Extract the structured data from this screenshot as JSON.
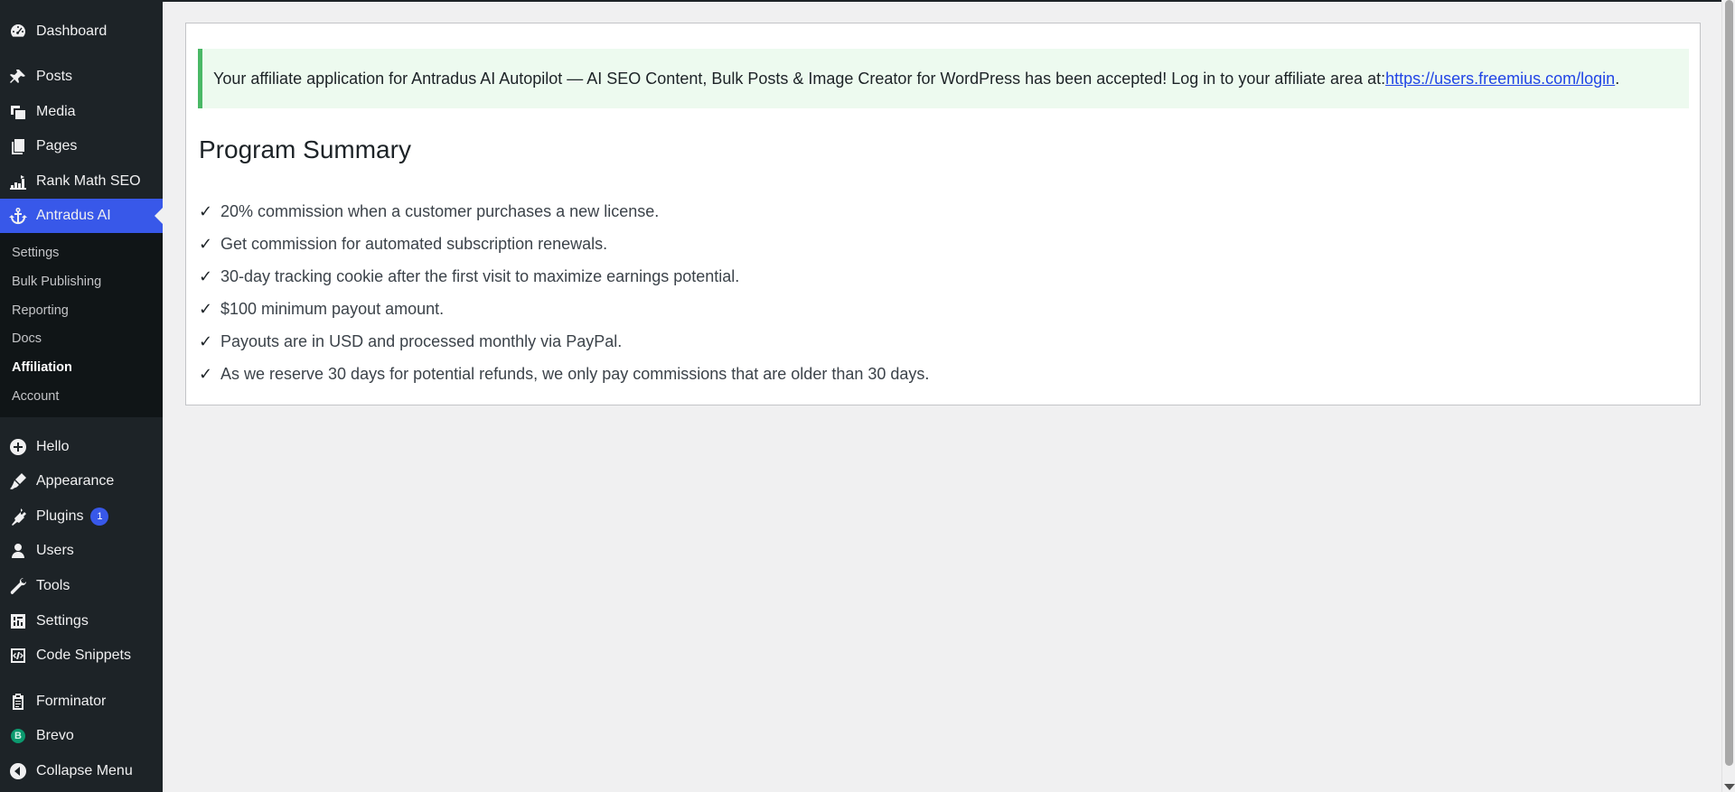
{
  "sidebar": {
    "items": [
      {
        "key": "dashboard",
        "label": "Dashboard",
        "icon": "dashboard-icon"
      },
      {
        "key": "posts",
        "label": "Posts",
        "icon": "pin-icon"
      },
      {
        "key": "media",
        "label": "Media",
        "icon": "media-icon"
      },
      {
        "key": "pages",
        "label": "Pages",
        "icon": "pages-icon"
      },
      {
        "key": "rank-math-seo",
        "label": "Rank Math SEO",
        "icon": "chart-icon"
      },
      {
        "key": "antradus-ai",
        "label": "Antradus AI",
        "icon": "anchor-icon"
      },
      {
        "key": "hello",
        "label": "Hello",
        "icon": "plus-circle-icon"
      },
      {
        "key": "appearance",
        "label": "Appearance",
        "icon": "brush-icon"
      },
      {
        "key": "plugins",
        "label": "Plugins",
        "icon": "plug-icon",
        "badge": "1"
      },
      {
        "key": "users",
        "label": "Users",
        "icon": "user-icon"
      },
      {
        "key": "tools",
        "label": "Tools",
        "icon": "wrench-icon"
      },
      {
        "key": "settings",
        "label": "Settings",
        "icon": "sliders-icon"
      },
      {
        "key": "code-snippets",
        "label": "Code Snippets",
        "icon": "code-icon"
      },
      {
        "key": "forminator",
        "label": "Forminator",
        "icon": "clipboard-icon"
      },
      {
        "key": "brevo",
        "label": "Brevo",
        "icon": "brevo-icon",
        "icon_letter": "B"
      },
      {
        "key": "collapse-menu",
        "label": "Collapse Menu",
        "icon": "collapse-icon"
      }
    ],
    "submenu": [
      {
        "label": "Settings"
      },
      {
        "label": "Bulk Publishing"
      },
      {
        "label": "Reporting"
      },
      {
        "label": "Docs"
      },
      {
        "label": "Affiliation",
        "current": true
      },
      {
        "label": "Account"
      }
    ]
  },
  "notice": {
    "text": "Your affiliate application for Antradus AI Autopilot — AI SEO Content, Bulk Posts & Image Creator for WordPress has been accepted! Log in to your affiliate area at: ",
    "link_text": "https://users.freemius.com/login",
    "suffix": "."
  },
  "summary": {
    "title": "Program Summary",
    "check": "✓",
    "items": [
      "20% commission when a customer purchases a new license.",
      "Get commission for automated subscription renewals.",
      "30-day tracking cookie after the first visit to maximize earnings potential.",
      "$100 minimum payout amount.",
      "Payouts are in USD and processed monthly via PayPal.",
      "As we reserve 30 days for potential refunds, we only pay commissions that are older than 30 days."
    ]
  }
}
